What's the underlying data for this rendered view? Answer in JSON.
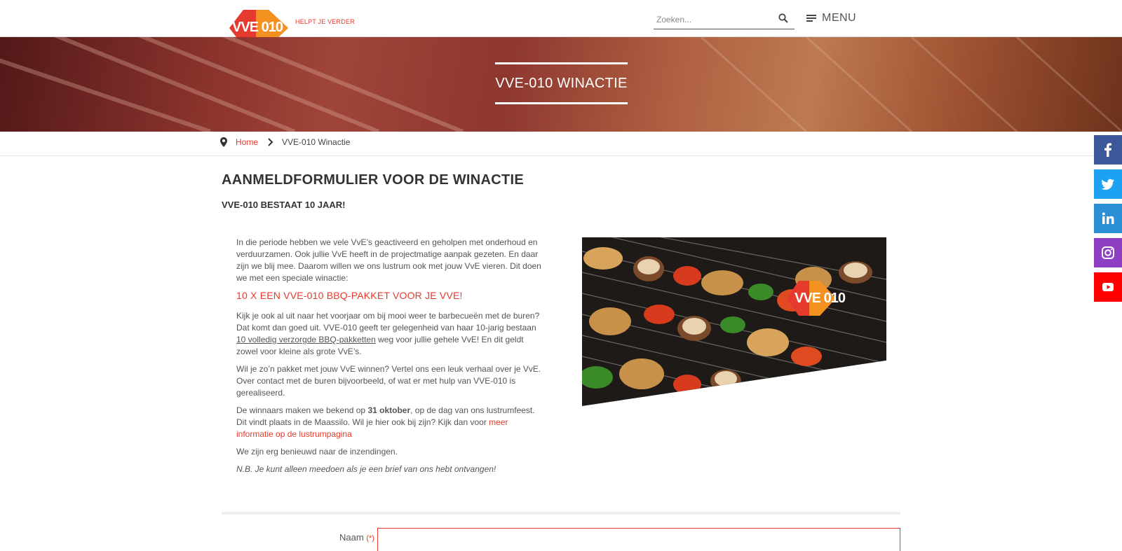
{
  "header": {
    "logo_text": "VVE 010",
    "tagline": "HELPT JE VERDER",
    "search_placeholder": "Zoeken...",
    "menu_label": "MENU"
  },
  "banner": {
    "title": "VVE-010 WINACTIE"
  },
  "breadcrumb": {
    "home": "Home",
    "current": "VVE-010 Winactie"
  },
  "social": [
    "facebook-icon",
    "twitter-icon",
    "linkedin-icon",
    "instagram-icon",
    "youtube-icon"
  ],
  "colors": {
    "accent": "#e63a2e",
    "orange": "#f39221",
    "facebook": "#3b5998",
    "twitter": "#1da1f2",
    "linkedin": "#2b8fd6",
    "instagram": "#8e3fc4",
    "youtube": "#ff0000"
  },
  "content": {
    "page_title": "AANMELDFORMULIER VOOR DE WINACTIE",
    "subtitle": "VVE-010 BESTAAT 10 JAAR!",
    "intro": "In die periode hebben we vele VvE’s geactiveerd en geholpen met onderhoud en verduurzamen. Ook jullie VvE heeft in de projectmatige aanpak gezeten. En daar zijn we blij mee. Daarom willen we ons lustrum ook met jouw VvE vieren. Dit doen we met een speciale winactie:",
    "prize": "10 X EEN VVE-010 BBQ-PAKKET VOOR JE VVE!",
    "p2_a": "Kijk je ook al uit naar het voorjaar om bij mooi weer te barbecueën met de buren? Dat komt dan goed uit. VVE-010 geeft ter gelegenheid van haar 10-jarig bestaan ",
    "p2_u": "10 volledig verzorgde BBQ-pakketten",
    "p2_b": " weg voor jullie gehele VvE! En dit geldt zowel voor kleine als grote VvE’s.",
    "p3": "Wil je zo’n pakket met jouw VvE winnen? Vertel ons een leuk verhaal over je VvE. Over contact met de buren bijvoorbeeld, of wat er met hulp van VVE-010 is gerealiseerd.",
    "p4_a": "De winnaars maken we bekend op ",
    "p4_bold": "31 oktober",
    "p4_b": ", op de dag van ons lustrumfeest. Dit vindt plaats in de Maassilo. Wil je hier ook bij zijn? Kijk dan voor ",
    "p4_link": "meer informatie op de lustrumpagina",
    "p5": "We zijn erg benieuwd naar de inzendingen.",
    "nb": "N.B. Je kunt alleen meedoen als je een brief van ons hebt ontvangen!"
  },
  "photo": {
    "logo_text": "VVE 010"
  },
  "form": {
    "name_label": "Naam",
    "required": "(*)",
    "name_value": ""
  }
}
